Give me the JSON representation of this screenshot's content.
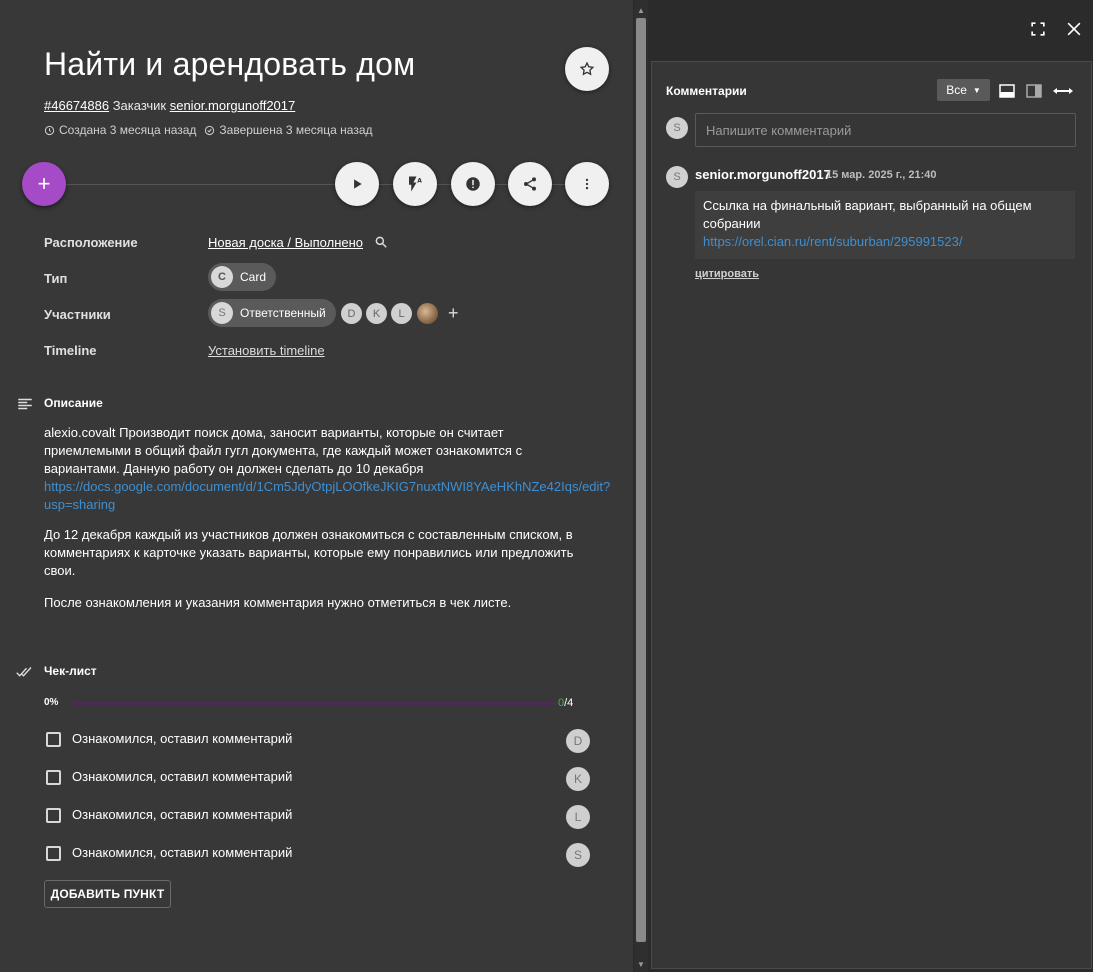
{
  "card": {
    "title": "Найти и арендовать дом",
    "id": "#46674886",
    "customer_prefix": "Заказчик",
    "customer": "senior.morgunoff2017",
    "created": "Создана 3 месяца назад",
    "completed": "Завершена 3 месяца назад"
  },
  "props": {
    "location_label": "Расположение",
    "location_value": "Новая доска / Выполнено",
    "type_label": "Тип",
    "type_value": "Card",
    "type_initial": "C",
    "members_label": "Участники",
    "responsible_label": "Ответственный",
    "responsible_initial": "S",
    "members": [
      "D",
      "K",
      "L"
    ],
    "timeline_label": "Timeline",
    "timeline_value": "Установить timeline"
  },
  "description": {
    "title": "Описание",
    "p1": "alexio.covalt Производит поиск дома, заносит варианты, которые он считает приемлемыми в общий файл гугл документа, где каждый может ознакомится с вариантами. Данную работу он должен сделать до 10 декабря",
    "p1_url": "https://docs.google.com/document/d/1Cm5JdyOtpjLOOfkeJKIG7nuxtNWI8YAeHKhNZe42Iqs/edit?usp=sharing",
    "p2": "До 12 декабря каждый из участников должен ознакомиться с составленным списком, в комментариях к карточке указать варианты, которые ему понравились или предложить свои.",
    "p3": "После ознакомления и указания комментария нужно отметиться в чек листе."
  },
  "checklist": {
    "title": "Чек-лист",
    "percent": "0%",
    "progress": 0,
    "done": "0",
    "total": "/4",
    "items": [
      {
        "label": "Ознакомился, оставил комментарий",
        "initial": "D"
      },
      {
        "label": "Ознакомился, оставил комментарий",
        "initial": "K"
      },
      {
        "label": "Ознакомился, оставил комментарий",
        "initial": "L"
      },
      {
        "label": "Ознакомился, оставил комментарий",
        "initial": "S"
      }
    ],
    "add_label": "ДОБАВИТЬ ПУНКТ"
  },
  "comments": {
    "title": "Комментарии",
    "filter": "Все",
    "input_initial": "S",
    "placeholder": "Напишите комментарий",
    "entries": [
      {
        "initial": "S",
        "author": "senior.morgunoff2017",
        "date": "15 мар. 2025 г., 21:40",
        "text": "Ссылка на финальный вариант, выбранный на общем собрании",
        "url": "https://orel.cian.ru/rent/suburban/295991523/",
        "quote": "цитировать"
      }
    ]
  },
  "colors": {
    "accent": "#a64bc7",
    "link": "#3f8fd0",
    "progress_done": "#4caf50"
  }
}
